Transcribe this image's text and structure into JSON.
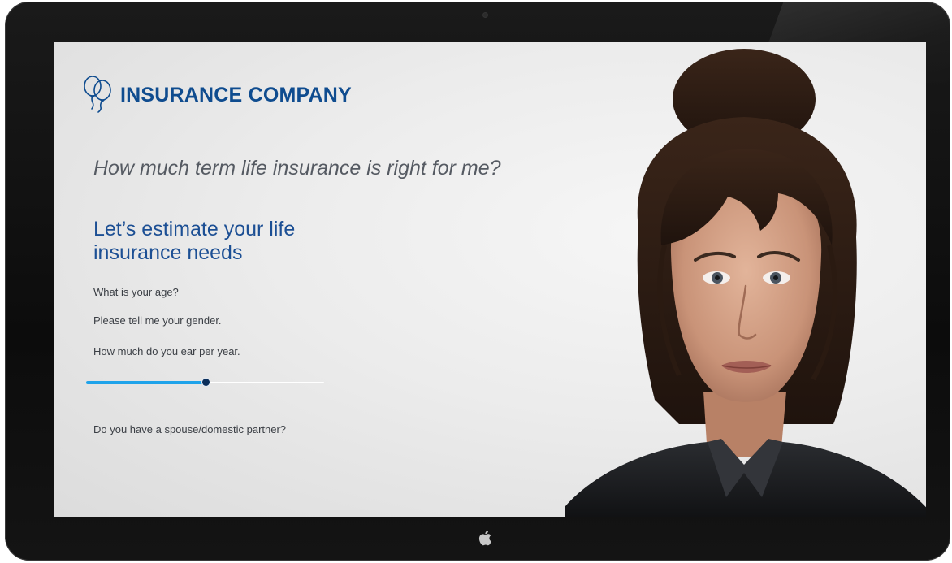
{
  "brand": {
    "name": "INSURANCE COMPANY",
    "icon": "balloons-icon",
    "color": "#0f4c8f"
  },
  "main": {
    "question": "How much term life insurance is right for me?",
    "subtitle_line1": "Let’s estimate your life",
    "subtitle_line2": "insurance needs",
    "questions": {
      "age": "What is your age?",
      "gender": "Please tell me your gender.",
      "income": "How much do you ear per year.",
      "partner": "Do you have a spouse/domestic partner?"
    },
    "income_slider": {
      "value_fraction": 0.5,
      "fill_color": "#1fa3ea"
    }
  },
  "avatar": {
    "kind": "virtual-assistant-woman"
  },
  "device": {
    "logo": "apple-icon"
  }
}
